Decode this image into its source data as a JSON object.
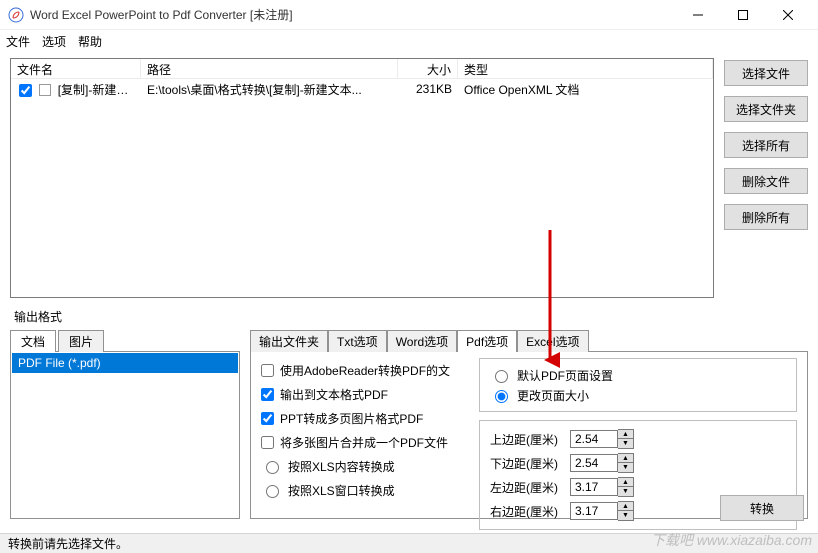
{
  "window": {
    "title": "Word Excel PowerPoint to Pdf Converter [未注册]"
  },
  "menu": {
    "file": "文件",
    "options": "选项",
    "help": "帮助"
  },
  "filelist": {
    "headers": {
      "name": "文件名",
      "path": "路径",
      "size": "大小",
      "type": "类型"
    },
    "row": {
      "name": "[复制]-新建文本...",
      "path": "E:\\tools\\桌面\\格式转换\\[复制]-新建文本...",
      "size": "231KB",
      "type": "Office OpenXML 文档"
    }
  },
  "sidebar": {
    "add_file": "选择文件",
    "add_folder": "选择文件夹",
    "select_all": "选择所有",
    "delete_file": "删除文件",
    "delete_all": "删除所有"
  },
  "output_format_label": "输出格式",
  "format_tabs": {
    "doc": "文档",
    "pic": "图片"
  },
  "format_item": "PDF File  (*.pdf)",
  "opt_tabs": {
    "output": "输出文件夹",
    "txt": "Txt选项",
    "word": "Word选项",
    "pdf": "Pdf选项",
    "excel": "Excel选项"
  },
  "pdf_opts": {
    "use_adobe": "使用AdobeReader转换PDF的文",
    "out_to_text": "输出到文本格式PDF",
    "ppt_multi": "PPT转成多页图片格式PDF",
    "merge_imgs": "将多张图片合并成一个PDF文件",
    "xls_by_content": "按照XLS内容转换成",
    "xls_by_window": "按照XLS窗口转换成"
  },
  "page_radio": {
    "default": "默认PDF页面设置",
    "change": "更改页面大小"
  },
  "margins": {
    "top_label": "上边距(厘米)",
    "bottom_label": "下边距(厘米)",
    "left_label": "左边距(厘米)",
    "right_label": "右边距(厘米)",
    "top": "2.54",
    "bottom": "2.54",
    "left": "3.17",
    "right": "3.17"
  },
  "convert": "转换",
  "status": "转换前请先选择文件。",
  "watermark": "下载吧 www.xiazaiba.com"
}
